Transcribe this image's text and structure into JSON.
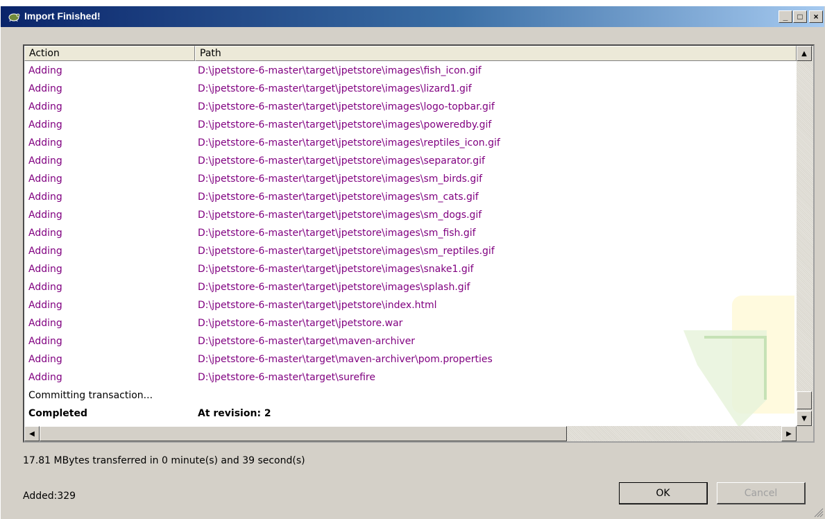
{
  "window": {
    "title": "Import Finished!"
  },
  "titlebar_buttons": {
    "minimize": "_",
    "maximize": "□",
    "close": "×"
  },
  "table": {
    "headers": {
      "action": "Action",
      "path": "Path"
    },
    "rows": [
      {
        "action": "Adding",
        "path": "D:\\jpetstore-6-master\\target\\jpetstore\\images\\fish_icon.gif"
      },
      {
        "action": "Adding",
        "path": "D:\\jpetstore-6-master\\target\\jpetstore\\images\\lizard1.gif"
      },
      {
        "action": "Adding",
        "path": "D:\\jpetstore-6-master\\target\\jpetstore\\images\\logo-topbar.gif"
      },
      {
        "action": "Adding",
        "path": "D:\\jpetstore-6-master\\target\\jpetstore\\images\\poweredby.gif"
      },
      {
        "action": "Adding",
        "path": "D:\\jpetstore-6-master\\target\\jpetstore\\images\\reptiles_icon.gif"
      },
      {
        "action": "Adding",
        "path": "D:\\jpetstore-6-master\\target\\jpetstore\\images\\separator.gif"
      },
      {
        "action": "Adding",
        "path": "D:\\jpetstore-6-master\\target\\jpetstore\\images\\sm_birds.gif"
      },
      {
        "action": "Adding",
        "path": "D:\\jpetstore-6-master\\target\\jpetstore\\images\\sm_cats.gif"
      },
      {
        "action": "Adding",
        "path": "D:\\jpetstore-6-master\\target\\jpetstore\\images\\sm_dogs.gif"
      },
      {
        "action": "Adding",
        "path": "D:\\jpetstore-6-master\\target\\jpetstore\\images\\sm_fish.gif"
      },
      {
        "action": "Adding",
        "path": "D:\\jpetstore-6-master\\target\\jpetstore\\images\\sm_reptiles.gif"
      },
      {
        "action": "Adding",
        "path": "D:\\jpetstore-6-master\\target\\jpetstore\\images\\snake1.gif"
      },
      {
        "action": "Adding",
        "path": "D:\\jpetstore-6-master\\target\\jpetstore\\images\\splash.gif"
      },
      {
        "action": "Adding",
        "path": "D:\\jpetstore-6-master\\target\\jpetstore\\index.html"
      },
      {
        "action": "Adding",
        "path": "D:\\jpetstore-6-master\\target\\jpetstore.war"
      },
      {
        "action": "Adding",
        "path": "D:\\jpetstore-6-master\\target\\maven-archiver"
      },
      {
        "action": "Adding",
        "path": "D:\\jpetstore-6-master\\target\\maven-archiver\\pom.properties"
      },
      {
        "action": "Adding",
        "path": "D:\\jpetstore-6-master\\target\\surefire"
      },
      {
        "action": "Committing transaction...",
        "path": "",
        "style": "black"
      },
      {
        "action": "Completed",
        "path": "At revision: 2",
        "style": "bold"
      }
    ]
  },
  "status": {
    "transfer": "17.81 MBytes transferred in 0 minute(s) and 39 second(s)",
    "added": "Added:329"
  },
  "buttons": {
    "ok": "OK",
    "cancel": "Cancel"
  },
  "colors": {
    "added_row": "#800080",
    "titlebar_start": "#0a246a",
    "titlebar_end": "#a6caf0"
  },
  "icons": [
    "tortoise-icon",
    "minimize-icon",
    "maximize-icon",
    "close-icon",
    "scroll-up-icon",
    "scroll-down-icon",
    "scroll-left-icon",
    "scroll-right-icon"
  ]
}
